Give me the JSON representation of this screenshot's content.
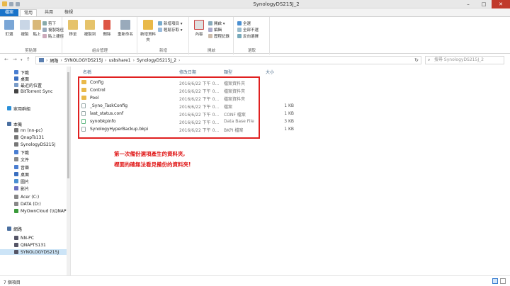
{
  "window": {
    "title": "SynologyDS215J_2"
  },
  "tabs": [
    "檔案",
    "常用",
    "共用",
    "檢視"
  ],
  "ribbon": {
    "groups": [
      {
        "label": "剪貼簿",
        "big": [
          "釘選",
          "複製",
          "貼上"
        ],
        "small": [
          "剪下",
          "複製路徑",
          "貼上捷徑"
        ]
      },
      {
        "label": "組合管理",
        "big": [
          "移至",
          "複製到",
          "刪除",
          "重新命名"
        ],
        "small": []
      },
      {
        "label": "新增",
        "big": [
          "新增資料夾"
        ],
        "small": [
          "新增項目 ▾",
          "輕鬆存取 ▾"
        ]
      },
      {
        "label": "開啟",
        "big": [
          "內容"
        ],
        "small": [
          "開啟 ▾",
          "編輯",
          "歷程記錄"
        ]
      },
      {
        "label": "選取",
        "big": [],
        "small": [
          "全選",
          "全部不選",
          "反向選擇"
        ]
      }
    ]
  },
  "address": {
    "crumbs": [
      "網路",
      "SYNOLOGYDS215J",
      "usbshare1",
      "SynologyDS215J_2"
    ],
    "search_placeholder": "搜尋 SynologyDS215J_2"
  },
  "nav": {
    "items": [
      {
        "label": "下載",
        "indent": 1,
        "color": "#4a7ed1"
      },
      {
        "label": "桌面",
        "indent": 1,
        "color": "#3b6fc0"
      },
      {
        "label": "最近的位置",
        "indent": 1,
        "color": "#7a9cc8"
      },
      {
        "label": "BitTorrent Sync",
        "indent": 1,
        "color": "#444"
      },
      {
        "label": "家用群組",
        "indent": 0,
        "color": "#2a8fd8"
      },
      {
        "label": "本機",
        "indent": 0,
        "color": "#4a6fa0"
      },
      {
        "label": "nn (nn-pc)",
        "indent": 1,
        "color": "#777"
      },
      {
        "label": "QnapTs131",
        "indent": 1,
        "color": "#777"
      },
      {
        "label": "SynologyDS215J",
        "indent": 1,
        "color": "#777"
      },
      {
        "label": "下載",
        "indent": 1,
        "color": "#4a7ed1"
      },
      {
        "label": "文件",
        "indent": 1,
        "color": "#888"
      },
      {
        "label": "音樂",
        "indent": 1,
        "color": "#4a7ed1"
      },
      {
        "label": "桌面",
        "indent": 1,
        "color": "#3b6fc0"
      },
      {
        "label": "圖片",
        "indent": 1,
        "color": "#4a8fd1"
      },
      {
        "label": "影片",
        "indent": 1,
        "color": "#6a6fc0"
      },
      {
        "label": "Acer (C:)",
        "indent": 1,
        "color": "#888"
      },
      {
        "label": "DATA (D:)",
        "indent": 1,
        "color": "#888"
      },
      {
        "label": "MyOwnCloud (\\\\QNAP",
        "indent": 1,
        "color": "#3a9a3a"
      },
      {
        "label": "網路",
        "indent": 0,
        "color": "#4a6fa0"
      },
      {
        "label": "NN-PC",
        "indent": 1,
        "color": "#556"
      },
      {
        "label": "QNAPTS131",
        "indent": 1,
        "color": "#556"
      },
      {
        "label": "SYNOLOGYDS215J",
        "indent": 1,
        "color": "#556"
      }
    ]
  },
  "columns": {
    "name": "名稱",
    "date": "修改日期",
    "type": "類型",
    "size": "大小"
  },
  "files": [
    {
      "name": "Config",
      "date": "2016/6/22 下午 0...",
      "type": "檔案資料夾",
      "size": "",
      "kind": "folder"
    },
    {
      "name": "Control",
      "date": "2016/6/22 下午 0...",
      "type": "檔案資料夾",
      "size": "",
      "kind": "folder"
    },
    {
      "name": "Pool",
      "date": "2016/6/22 下午 0...",
      "type": "檔案資料夾",
      "size": "",
      "kind": "folder"
    },
    {
      "name": "_Syno_TaskConfig",
      "date": "2016/6/22 下午 0...",
      "type": "檔案",
      "size": "1 KB",
      "kind": "file"
    },
    {
      "name": "last_status.conf",
      "date": "2016/6/22 下午 0...",
      "type": "CONF 檔案",
      "size": "1 KB",
      "kind": "file"
    },
    {
      "name": "synobkpinfo",
      "date": "2016/6/22 下午 0...",
      "type": "Data Base File",
      "size": "3 KB",
      "kind": "db"
    },
    {
      "name": "SynologyHyperBackup.bkpi",
      "date": "2016/6/22 下午 0...",
      "type": "BKPI 檔案",
      "size": "1 KB",
      "kind": "file"
    }
  ],
  "annotation": {
    "line1": "第一次備份選項產生的資料夾,",
    "line2": "裡面的確無法看見備份的資料夾!"
  },
  "status": {
    "count": "7 個項目"
  }
}
